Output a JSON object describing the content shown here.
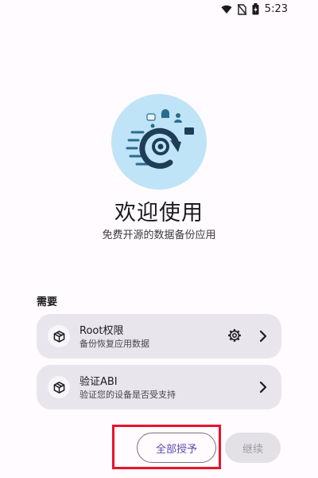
{
  "status_bar": {
    "time": "5:23",
    "icons": [
      "wifi-icon",
      "no-sim-icon",
      "battery-icon"
    ]
  },
  "hero": {
    "icon": "backup-restore-icon",
    "title": "欢迎使用",
    "subtitle": "免费开源的数据备份应用"
  },
  "requirements": {
    "section_label": "需要",
    "items": [
      {
        "icon": "package-icon",
        "title": "Root权限",
        "subtitle": "备份恢复应用数据",
        "has_settings": true,
        "chevron": "chevron-right-icon"
      },
      {
        "icon": "package-icon",
        "title": "验证ABI",
        "subtitle": "验证您的设备是否受支持",
        "has_settings": false,
        "chevron": "chevron-right-icon"
      }
    ]
  },
  "actions": {
    "grant_all_label": "全部授予",
    "continue_label": "继续",
    "continue_enabled": false
  },
  "colors": {
    "accent": "#5d4bb3",
    "hero_bg": "#bfe4f7",
    "card_bg": "#e9e5ec",
    "highlight": "#e8132b"
  }
}
